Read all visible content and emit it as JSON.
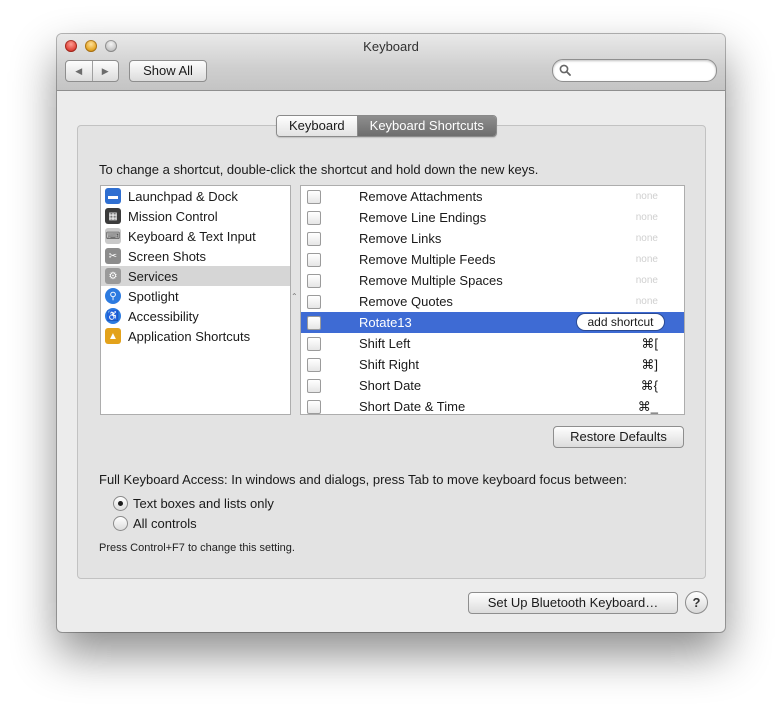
{
  "window": {
    "title": "Keyboard"
  },
  "toolbar": {
    "back_glyph": "◀",
    "forward_glyph": "▶",
    "show_all_label": "Show All",
    "search_placeholder": ""
  },
  "tabs": [
    {
      "label": "Keyboard",
      "selected": false
    },
    {
      "label": "Keyboard Shortcuts",
      "selected": true
    }
  ],
  "instructions": "To change a shortcut, double-click the shortcut and hold down the new keys.",
  "categories": [
    {
      "label": "Launchpad & Dock",
      "icon": "launchpad-dock-icon",
      "color": "#2f6fd1",
      "selected": false
    },
    {
      "label": "Mission Control",
      "icon": "mission-control-icon",
      "color": "#3b3b3b",
      "selected": false
    },
    {
      "label": "Keyboard & Text Input",
      "icon": "keyboard-icon",
      "color": "#c9c9c9",
      "selected": false
    },
    {
      "label": "Screen Shots",
      "icon": "screenshot-icon",
      "color": "#8c8c8c",
      "selected": false
    },
    {
      "label": "Services",
      "icon": "gear-icon",
      "color": "#9a9a9a",
      "selected": true
    },
    {
      "label": "Spotlight",
      "icon": "spotlight-icon",
      "color": "#2d7be0",
      "selected": false
    },
    {
      "label": "Accessibility",
      "icon": "accessibility-icon",
      "color": "#2d7be0",
      "selected": false
    },
    {
      "label": "Application Shortcuts",
      "icon": "app-shortcuts-icon",
      "color": "#e3a21b",
      "selected": false
    }
  ],
  "shortcuts": [
    {
      "name": "Remove Attachments",
      "key": "none",
      "selected": false
    },
    {
      "name": "Remove Line Endings",
      "key": "none",
      "selected": false
    },
    {
      "name": "Remove Links",
      "key": "none",
      "selected": false
    },
    {
      "name": "Remove Multiple Feeds",
      "key": "none",
      "selected": false
    },
    {
      "name": "Remove Multiple Spaces",
      "key": "none",
      "selected": false
    },
    {
      "name": "Remove Quotes",
      "key": "none",
      "selected": false
    },
    {
      "name": "Rotate13",
      "key": "add shortcut",
      "selected": true
    },
    {
      "name": "Shift Left",
      "key": "⌘[",
      "selected": false
    },
    {
      "name": "Shift Right",
      "key": "⌘]",
      "selected": false
    },
    {
      "name": "Short Date",
      "key": "⌘{",
      "selected": false
    },
    {
      "name": "Short Date & Time",
      "key": "⌘_",
      "selected": false
    }
  ],
  "restore_label": "Restore Defaults",
  "full_keyboard_access": {
    "label": "Full Keyboard Access: In windows and dialogs, press Tab to move keyboard focus between:",
    "options": [
      {
        "label": "Text boxes and lists only",
        "checked": true
      },
      {
        "label": "All controls",
        "checked": false
      }
    ],
    "hint": "Press Control+F7 to change this setting."
  },
  "bluetooth_label": "Set Up Bluetooth Keyboard…",
  "help_label": "?",
  "splitter_glyph": "⌃"
}
